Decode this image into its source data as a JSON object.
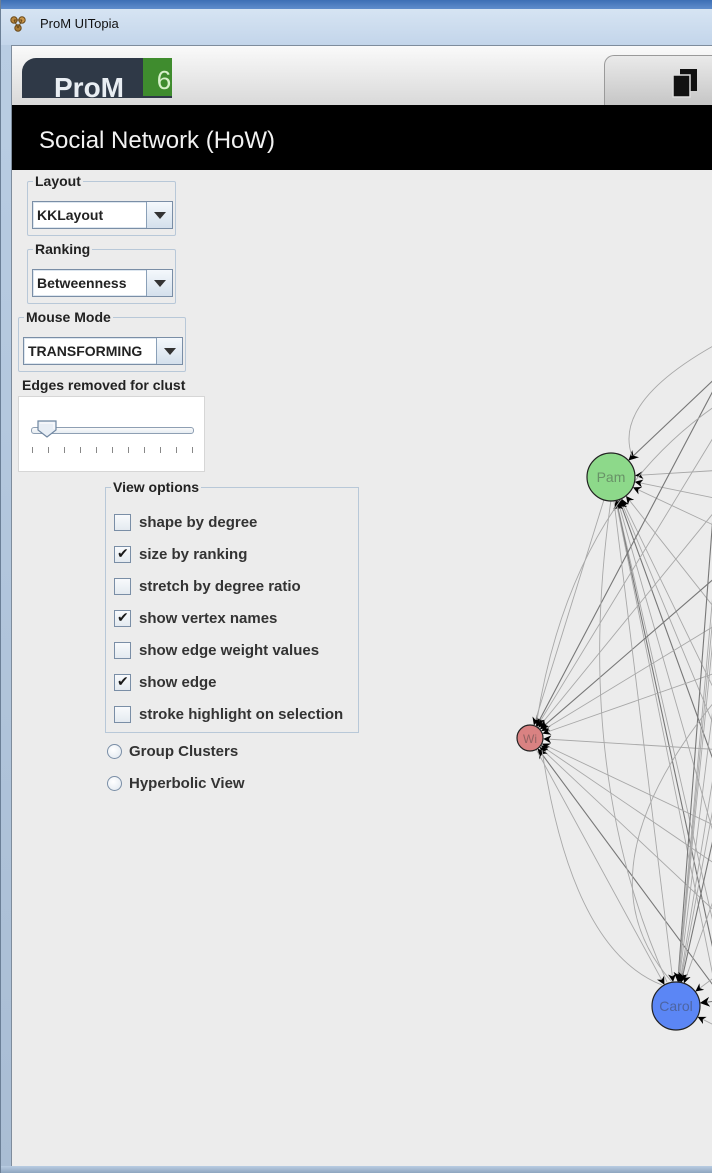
{
  "window": {
    "title": "ProM UITopia"
  },
  "logo": {
    "text": "ProM",
    "version": "6"
  },
  "view": {
    "title": "Social Network (HoW)"
  },
  "controls": {
    "layout": {
      "label": "Layout",
      "value": "KKLayout"
    },
    "ranking": {
      "label": "Ranking",
      "value": "Betweenness"
    },
    "mouse_mode": {
      "label": "Mouse Mode",
      "value": "TRANSFORMING"
    },
    "edges_removed": {
      "label": "Edges removed for clust",
      "value_fraction": 0.1
    }
  },
  "view_options": {
    "label": "View options",
    "items": [
      {
        "label": "shape by degree",
        "checked": false
      },
      {
        "label": "size by ranking",
        "checked": true
      },
      {
        "label": "stretch by degree ratio",
        "checked": false
      },
      {
        "label": "show vertex names",
        "checked": true
      },
      {
        "label": "show edge weight values",
        "checked": false
      },
      {
        "label": "show edge",
        "checked": true
      },
      {
        "label": "stroke highlight on selection",
        "checked": false
      }
    ],
    "check_mark": "✔"
  },
  "radios": [
    {
      "label": "Group Clusters",
      "selected": false
    },
    {
      "label": "Hyperbolic View",
      "selected": false
    }
  ],
  "graph": {
    "nodes": [
      {
        "label": "Pam",
        "color": "#8dd98a"
      },
      {
        "label": "Wi",
        "color": "#d98282"
      },
      {
        "label": "Carol",
        "color": "#5b86f5"
      }
    ],
    "edge_color": "#a8a8a8"
  }
}
